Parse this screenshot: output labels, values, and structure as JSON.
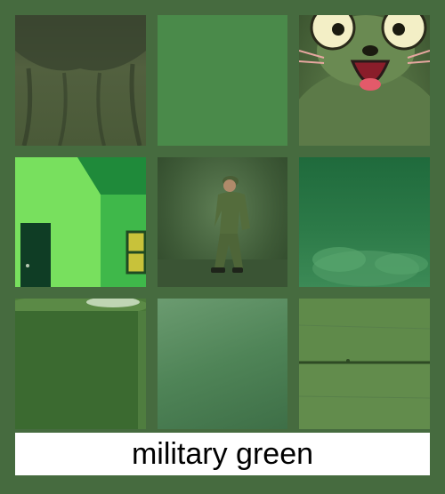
{
  "caption": "military green",
  "colors": {
    "background": "#466b3f",
    "swatch": "#4a8a4a",
    "caption_bg": "#ffffff"
  },
  "tiles": [
    "draped-fabric",
    "solid-green-swatch",
    "cartoon-cat",
    "green-house",
    "soldier",
    "green-abstract",
    "green-cup",
    "green-gradient",
    "wood-planks"
  ]
}
